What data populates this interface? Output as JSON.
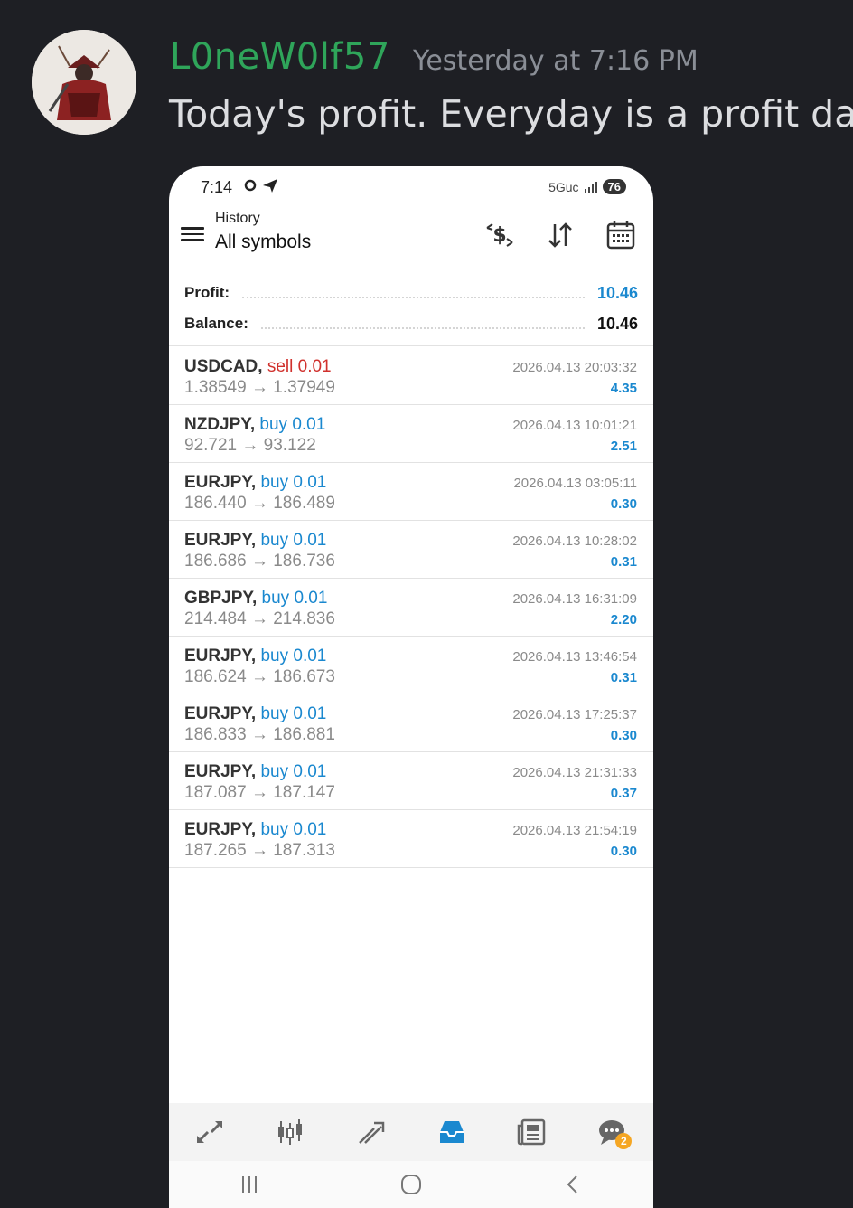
{
  "post": {
    "username": "L0neW0lf57",
    "timestamp": "Yesterday at 7:16 PM",
    "message": "Today's profit. Everyday is a profit day."
  },
  "colors": {
    "username": "#2fa55a",
    "buy": "#1a88cf",
    "sell": "#d0312d",
    "profit": "#1a88cf"
  },
  "status_bar": {
    "time": "7:14",
    "network": "5Guc",
    "battery": "76"
  },
  "toolbar": {
    "subtitle": "History",
    "title": "All symbols"
  },
  "summary": {
    "profit_label": "Profit:",
    "profit_value": "10.46",
    "balance_label": "Balance:",
    "balance_value": "10.46"
  },
  "deals": [
    {
      "symbol": "USDCAD,",
      "side": "sell 0.01",
      "type": "sell",
      "prices": "1.38549 → 1.37949",
      "time": "2026.04.13 20:03:32",
      "profit": "4.35"
    },
    {
      "symbol": "NZDJPY,",
      "side": "buy 0.01",
      "type": "buy",
      "prices": "92.721 → 93.122",
      "time": "2026.04.13 10:01:21",
      "profit": "2.51"
    },
    {
      "symbol": "EURJPY,",
      "side": "buy 0.01",
      "type": "buy",
      "prices": "186.440 → 186.489",
      "time": "2026.04.13 03:05:11",
      "profit": "0.30"
    },
    {
      "symbol": "EURJPY,",
      "side": "buy 0.01",
      "type": "buy",
      "prices": "186.686 → 186.736",
      "time": "2026.04.13 10:28:02",
      "profit": "0.31"
    },
    {
      "symbol": "GBPJPY,",
      "side": "buy 0.01",
      "type": "buy",
      "prices": "214.484 → 214.836",
      "time": "2026.04.13 16:31:09",
      "profit": "2.20"
    },
    {
      "symbol": "EURJPY,",
      "side": "buy 0.01",
      "type": "buy",
      "prices": "186.624 → 186.673",
      "time": "2026.04.13 13:46:54",
      "profit": "0.31"
    },
    {
      "symbol": "EURJPY,",
      "side": "buy 0.01",
      "type": "buy",
      "prices": "186.833 → 186.881",
      "time": "2026.04.13 17:25:37",
      "profit": "0.30"
    },
    {
      "symbol": "EURJPY,",
      "side": "buy 0.01",
      "type": "buy",
      "prices": "187.087 → 187.147",
      "time": "2026.04.13 21:31:33",
      "profit": "0.37"
    },
    {
      "symbol": "EURJPY,",
      "side": "buy 0.01",
      "type": "buy",
      "prices": "187.265 → 187.313",
      "time": "2026.04.13 21:54:19",
      "profit": "0.30"
    }
  ],
  "bottom_nav": {
    "items": [
      "quotes-icon",
      "chart-icon",
      "trade-icon",
      "history-icon",
      "news-icon",
      "chat-icon"
    ],
    "active": "history-icon",
    "chat_badge": "2"
  },
  "icons": {
    "toolbar": [
      "deposit-filter-icon",
      "sort-icon",
      "calendar-icon"
    ],
    "menu": "hamburger-menu-icon"
  }
}
